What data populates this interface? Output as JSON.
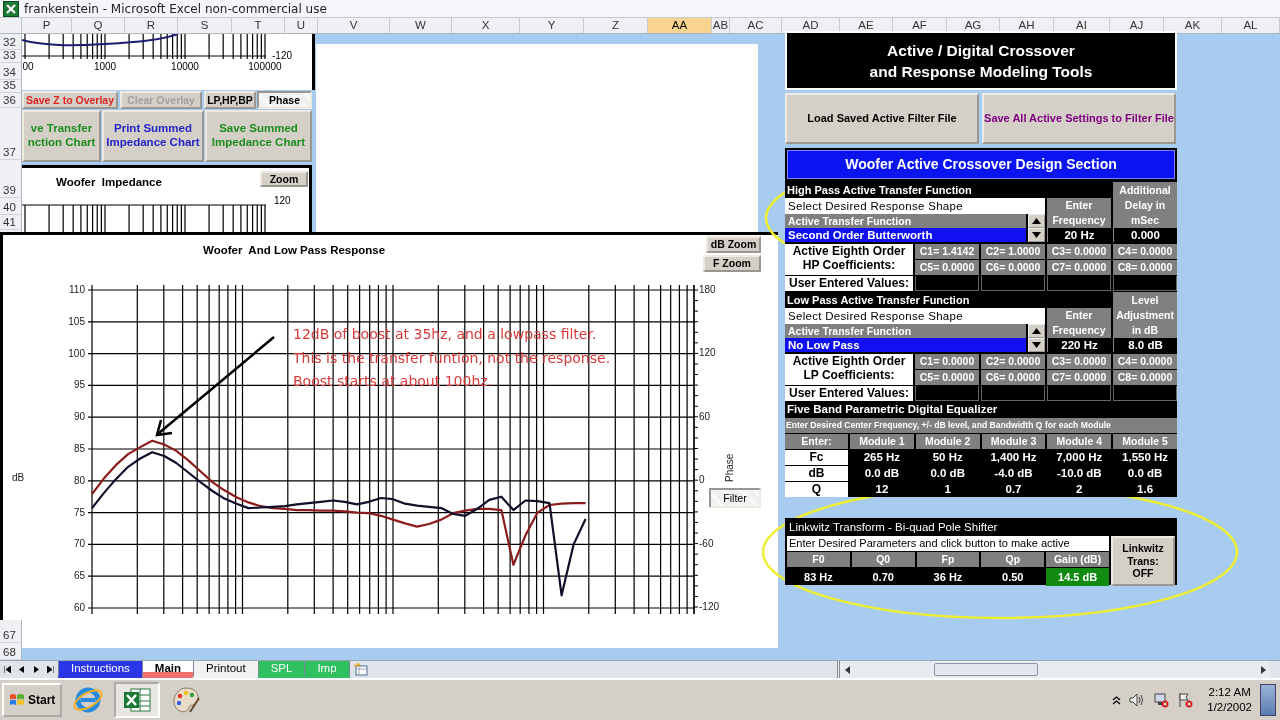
{
  "window": {
    "title": "frankenstein - Microsoft Excel non-commercial use"
  },
  "columns": [
    {
      "label": "P",
      "selected": false
    },
    {
      "label": "Q",
      "selected": false
    },
    {
      "label": "R",
      "selected": false
    },
    {
      "label": "S",
      "selected": false
    },
    {
      "label": "T",
      "selected": false
    },
    {
      "label": "U",
      "selected": false
    },
    {
      "label": "V",
      "selected": false
    },
    {
      "label": "W",
      "selected": false
    },
    {
      "label": "X",
      "selected": false
    },
    {
      "label": "Y",
      "selected": false
    },
    {
      "label": "Z",
      "selected": false
    },
    {
      "label": "AA",
      "selected": true
    },
    {
      "label": "AB",
      "selected": false
    },
    {
      "label": "AC",
      "selected": false
    },
    {
      "label": "AD",
      "selected": false
    },
    {
      "label": "AE",
      "selected": false
    },
    {
      "label": "AF",
      "selected": false
    },
    {
      "label": "AG",
      "selected": false
    },
    {
      "label": "AH",
      "selected": false
    },
    {
      "label": "AI",
      "selected": false
    },
    {
      "label": "AJ",
      "selected": false
    },
    {
      "label": "AK",
      "selected": false
    },
    {
      "label": "AL",
      "selected": false
    }
  ],
  "row_headers": [
    "32",
    "33",
    "34",
    "35",
    "36",
    "37",
    "39",
    "40",
    "41",
    "67",
    "68"
  ],
  "overlay_chart": {
    "x_labels": [
      "00",
      "1000",
      "10000",
      "100000"
    ],
    "right_label": "-120"
  },
  "chart_buttons": [
    {
      "label": "Save Z to Overlay",
      "color": "#dd2222",
      "pressed": false
    },
    {
      "label": "Clear Overlay",
      "color": "#a0a0a0",
      "pressed": false
    },
    {
      "label": "LP,HP,BP",
      "color": "#000000",
      "pressed": false
    },
    {
      "label": "Phase",
      "color": "#000000",
      "pressed": true
    }
  ],
  "chart_action_buttons": [
    {
      "label": "ve Transfer\nnction Chart",
      "color": "#1e8c1e"
    },
    {
      "label": "Print Summed\nImpedance Chart",
      "color": "#2424c8"
    },
    {
      "label": "Save Summed\nImpedance Chart",
      "color": "#1e8c1e"
    }
  ],
  "impedance_chart": {
    "title": "Woofer  Impedance",
    "zoom_button": "Zoom",
    "right_label": "120"
  },
  "response_chart": {
    "title": "Woofer  And Low Pass Response",
    "zoom_buttons": [
      "dB Zoom",
      "F Zoom"
    ],
    "y2label": "Phase",
    "chart_data": {
      "type": "line",
      "grid": true,
      "ylabel": "dB",
      "ylim": [
        60,
        110
      ],
      "yticks": [
        110,
        105,
        100,
        95,
        90,
        85,
        80,
        75,
        70,
        65,
        60
      ],
      "categories": [
        null,
        null,
        null,
        null,
        null,
        null,
        null,
        null,
        null,
        null,
        null,
        null,
        null,
        null,
        null,
        null,
        null,
        null,
        null,
        null,
        null,
        null,
        null,
        null,
        null,
        null,
        null,
        null,
        null,
        null,
        null,
        null,
        null,
        null,
        null,
        null,
        null,
        null,
        null,
        null,
        null,
        null
      ],
      "series": [
        {
          "color": "#8b1c1c",
          "values": [
            77.9,
            80.4,
            82.5,
            84.2,
            85.3,
            86.3,
            85.7,
            84.7,
            83.2,
            81.5,
            79.8,
            78.5,
            77.4,
            76.6,
            76.0,
            75.7,
            75.6,
            75.4,
            75.4,
            75.3,
            75.3,
            75.2,
            75.0,
            74.9,
            74.5,
            73.9,
            73.3,
            72.8,
            73.2,
            73.9,
            74.9,
            75.3,
            75.6,
            75.6,
            75.4,
            66.8,
            71.4,
            75.0,
            76.2,
            76.4,
            76.5,
            76.5
          ]
        },
        {
          "color": "#10102a",
          "values": [
            75.7,
            78.1,
            80.3,
            82.2,
            83.5,
            84.5,
            83.9,
            82.8,
            81.3,
            79.8,
            78.4,
            77.2,
            76.4,
            75.7,
            75.8,
            75.9,
            76.0,
            76.3,
            76.5,
            76.7,
            76.9,
            76.7,
            76.3,
            76.7,
            77.3,
            77.1,
            76.4,
            76.1,
            75.9,
            75.7,
            74.8,
            74.5,
            75.6,
            77.0,
            77.5,
            75.4,
            76.9,
            76.8,
            76.5,
            62.0,
            70.0,
            74.0
          ]
        }
      ]
    },
    "y2ticks": [
      "180",
      "120",
      "60",
      "0",
      "-60",
      "-120"
    ],
    "filter_button": {
      "label": "Filter",
      "pressed": true
    },
    "annotation": "12dB of boost at 35hz, and a lowpass filter.\nThis is the transfer funtion, not the response.\nBoost starts at about 100hz."
  },
  "tools_header": "Active / Digital Crossover\nand Response Modeling Tools",
  "file_buttons": [
    {
      "label": "Load Saved Active Filter File",
      "color": "#000000"
    },
    {
      "label": "Save All Active Settings to Filter File",
      "color": "#800080"
    }
  ],
  "woofer_section": {
    "title": "Woofer Active Crossover Design Section",
    "filters": [
      {
        "heading": "High Pass Active Transfer Function",
        "select_label": "Select Desired Response Shape",
        "list_header": "Active Transfer Function",
        "selected_value": "Second Order Butterworth",
        "freq_header": "Enter\nFrequency",
        "freq_value": "20 Hz",
        "extra_header": "Additional\nDelay in\nmSec",
        "extra_value": "0.000",
        "coef_label": "Active Eighth Order\nHP  Coefficients:",
        "coefficients": [
          "C1= 1.4142",
          "C2= 1.0000",
          "C3= 0.0000",
          "C4= 0.0000",
          "C5= 0.0000",
          "C6= 0.0000",
          "C7= 0.0000",
          "C8= 0.0000"
        ],
        "user_label": "User Entered Values:"
      },
      {
        "heading": "Low Pass Active Transfer Function",
        "select_label": "Select Desired Response Shape",
        "list_header": "Active Transfer Function",
        "selected_value": "No Low Pass",
        "freq_header": "Enter\nFrequency",
        "freq_value": "220 Hz",
        "extra_header": "Level\nAdjustment\nin dB",
        "extra_value": "8.0 dB",
        "coef_label": "Active Eighth Order\nLP  Coefficients:",
        "coefficients": [
          "C1= 0.0000",
          "C2= 0.0000",
          "C3= 0.0000",
          "C4= 0.0000",
          "C5= 0.0000",
          "C6= 0.0000",
          "C7= 0.0000",
          "C8= 0.0000"
        ],
        "user_label": "User Entered Values:"
      }
    ],
    "equalizer": {
      "heading": "Five Band Parametric Digital Equalizer",
      "instructions": "Enter Desired Center Frequency, +/- dB level, and Bandwidth Q for each Module",
      "corner": "Enter:",
      "modules": [
        "Module 1",
        "Module 2",
        "Module 3",
        "Module 4",
        "Module 5"
      ],
      "rows": [
        {
          "label": "Fc",
          "values": [
            "265 Hz",
            "50 Hz",
            "1,400 Hz",
            "7,000 Hz",
            "1,550 Hz"
          ]
        },
        {
          "label": "dB",
          "values": [
            "0.0 dB",
            "0.0 dB",
            "-4.0 dB",
            "-10.0 dB",
            "0.0 dB"
          ]
        },
        {
          "label": "Q",
          "values": [
            "12",
            "1",
            "0.7",
            "2",
            "1.6"
          ]
        }
      ]
    }
  },
  "linkwitz": {
    "title": "Linkwitz Transform - Bi-quad Pole Shifter",
    "instructions": "Enter Desired Parameters  and click button to make active",
    "params": [
      {
        "label": "F0",
        "value": "83 Hz",
        "highlight": false
      },
      {
        "label": "Q0",
        "value": "0.70",
        "highlight": false
      },
      {
        "label": "Fp",
        "value": "36 Hz",
        "highlight": false
      },
      {
        "label": "Qp",
        "value": "0.50",
        "highlight": false
      },
      {
        "label": "Gain (dB)",
        "value": "14.5 dB",
        "highlight": true
      }
    ],
    "button": "Linkwitz\nTrans:\nOFF"
  },
  "sheet_tabs": [
    {
      "label": "Instructions",
      "selected": false,
      "color": "#2a36e8"
    },
    {
      "label": "Main",
      "selected": true,
      "color": "#f07070"
    },
    {
      "label": "Printout",
      "selected": false,
      "color": "#f2f2f2"
    },
    {
      "label": "SPL",
      "selected": false,
      "color": "#30c060"
    },
    {
      "label": "Imp",
      "selected": false,
      "color": "#30c060"
    }
  ],
  "taskbar": {
    "start": "Start",
    "apps": [
      {
        "kind": "browser",
        "active": false
      },
      {
        "kind": "spreadsheet",
        "active": true
      },
      {
        "kind": "paint",
        "active": false
      }
    ],
    "time": "2:12 AM",
    "date": "1/2/2002"
  }
}
